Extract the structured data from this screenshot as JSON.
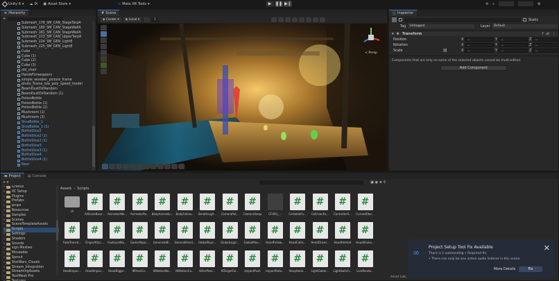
{
  "toolbar": {
    "account": "Unity 6",
    "cloud": "IX",
    "asset_store": "Asset Store",
    "meta_tools": "Meta XR Tools"
  },
  "hierarchy": {
    "tab": "Hierarchy",
    "items": [
      {
        "label": "Submesh_178_SM_CAN_StageTarpA",
        "sel": false
      },
      {
        "label": "Submesh_180_SM_CAN_StageWallA",
        "sel": false
      },
      {
        "label": "Submesh_181_SM_CAN_StageWallA",
        "sel": false
      },
      {
        "label": "Submesh_223_SM_CAN_UpperTarpA",
        "sel": false
      },
      {
        "label": "Submesh_224_SM_GEN_LightE",
        "sel": false
      },
      {
        "label": "Submesh_225_SM_GEN_LightE",
        "sel": false
      },
      {
        "label": "Cube",
        "sel": false
      },
      {
        "label": "Cube (1)",
        "sel": false
      },
      {
        "label": "Cube (2)",
        "sel": false
      },
      {
        "label": "Cube (3)",
        "sel": false
      },
      {
        "label": "old_chair",
        "sel": false
      },
      {
        "label": "HandsForweapons",
        "sel": false
      },
      {
        "label": "simple_wooden_picture_frame",
        "sel": false
      },
      {
        "label": "photo_frame_low_poly_speed_model",
        "sel": false
      },
      {
        "label": "BeamDustDirRandom",
        "sel": false
      },
      {
        "label": "BeamDustDirRandom (1)",
        "sel": false
      },
      {
        "label": "PotionBottle",
        "sel": false
      },
      {
        "label": "PotionBottle (1)",
        "sel": false
      },
      {
        "label": "PotionBottle (2)",
        "sel": false
      },
      {
        "label": "Mushroom (1)",
        "sel": false
      },
      {
        "label": "Mushroom (3)",
        "sel": false
      },
      {
        "label": "SliceBottle_1",
        "sel": true
      },
      {
        "label": "SliceBottle_1 (1)",
        "sel": true
      },
      {
        "label": "BottleSlice2",
        "sel": true
      },
      {
        "label": "BottleSlice2 (2)",
        "sel": true
      },
      {
        "label": "BottleSlice2 (1)",
        "sel": true
      },
      {
        "label": "BottleSlice3",
        "sel": true
      },
      {
        "label": "BottleSlice3 (1)",
        "sel": true
      },
      {
        "label": "BottleSlice4",
        "sel": true
      },
      {
        "label": "BottleSlice4 (1)",
        "sel": true
      },
      {
        "label": "Near",
        "sel": true
      }
    ]
  },
  "scene": {
    "tab": "Scene",
    "pivot": "Center",
    "space": "Local",
    "snap_value": "1",
    "persp_label": "< Persp"
  },
  "inspector": {
    "tab": "Inspector",
    "static_label": "Static",
    "tag_label": "Tag",
    "tag_value": "Untagged",
    "layer_label": "Layer",
    "layer_value": "Default",
    "component": "Transform",
    "position": "Position",
    "rotation": "Rotation",
    "scale": "Scale",
    "field_value": "—",
    "axis_x": "X",
    "axis_y": "Y",
    "axis_z": "Z",
    "multi_note": "Components that are only on some of the selected objects cannot be multi-edited.",
    "add_component": "Add Component"
  },
  "project": {
    "tab_project": "Project",
    "tab_console": "Console",
    "breadcrumb_root": "Assets",
    "breadcrumb_leaf": "Scripts",
    "tree": [
      "Gradus",
      "XC Setup",
      "Plugins",
      "Prefabs",
      "props",
      "Resources",
      "Samples",
      "Scenes",
      "SceneTemplateAssets",
      "Scripts",
      "Settings",
      "Shaders",
      "Sounds",
      "sign Meshes",
      "Moveable",
      "Sprout",
      "StarWars_Clouds",
      "Stream_Integration",
      "StreamingAssets",
      "TextMesh Pro",
      "Textures",
      "Thresholds"
    ],
    "footer": "Asset Lab..."
  },
  "assets": {
    "row1": [
      "Ul",
      "AllScaleBase...",
      "AnimatorWa...",
      "AnimatorRa...",
      "BodyAnimato...",
      "BodyFollow...",
      "BreathingA...",
      "CameraPat...",
      "CameraSwap",
      "CFX93_...",
      "ColliableFo...",
      "CollisionFo...",
      "ControllerS...",
      "CurvedObe..."
    ],
    "row2": [
      "FadeTransit...",
      "FingerAttac...",
      "FootLockIKo...",
      "GameObjec...",
      "GenerateBl...",
      "GeneralHand...",
      "GlobalRayc...",
      "GlobalLogic...",
      "GlobalMou...",
      "HandFollow...",
      "HeadCollis...",
      "HeadDriver...",
      "HeadHelmet",
      "HeadShake..."
    ],
    "row3": [
      "HeadImpac...",
      "HeadImpac...",
      "HeadRigge...",
      "IKPoseCo...",
      "IKMotionNo...",
      "IKMotionCa...",
      "KillerPose...",
      "IKTargetFol...",
      "ImpactPush",
      "ImpactRota...",
      "KeepHoriz...",
      "LightGaber...",
      "LightSwitch...",
      "LiveRenda..."
    ]
  },
  "notification": {
    "title": "Project Setup Tool Fix Available",
    "line1": "There is 1 outstanding • Required fix:",
    "line2": "• There can only be one active audio listener in this scene",
    "details": "More Details",
    "fix": "Fix"
  },
  "colors": {
    "accent": "#3b78c4",
    "selection_text": "#6fa8e0",
    "script_green": "#2f8a43"
  }
}
